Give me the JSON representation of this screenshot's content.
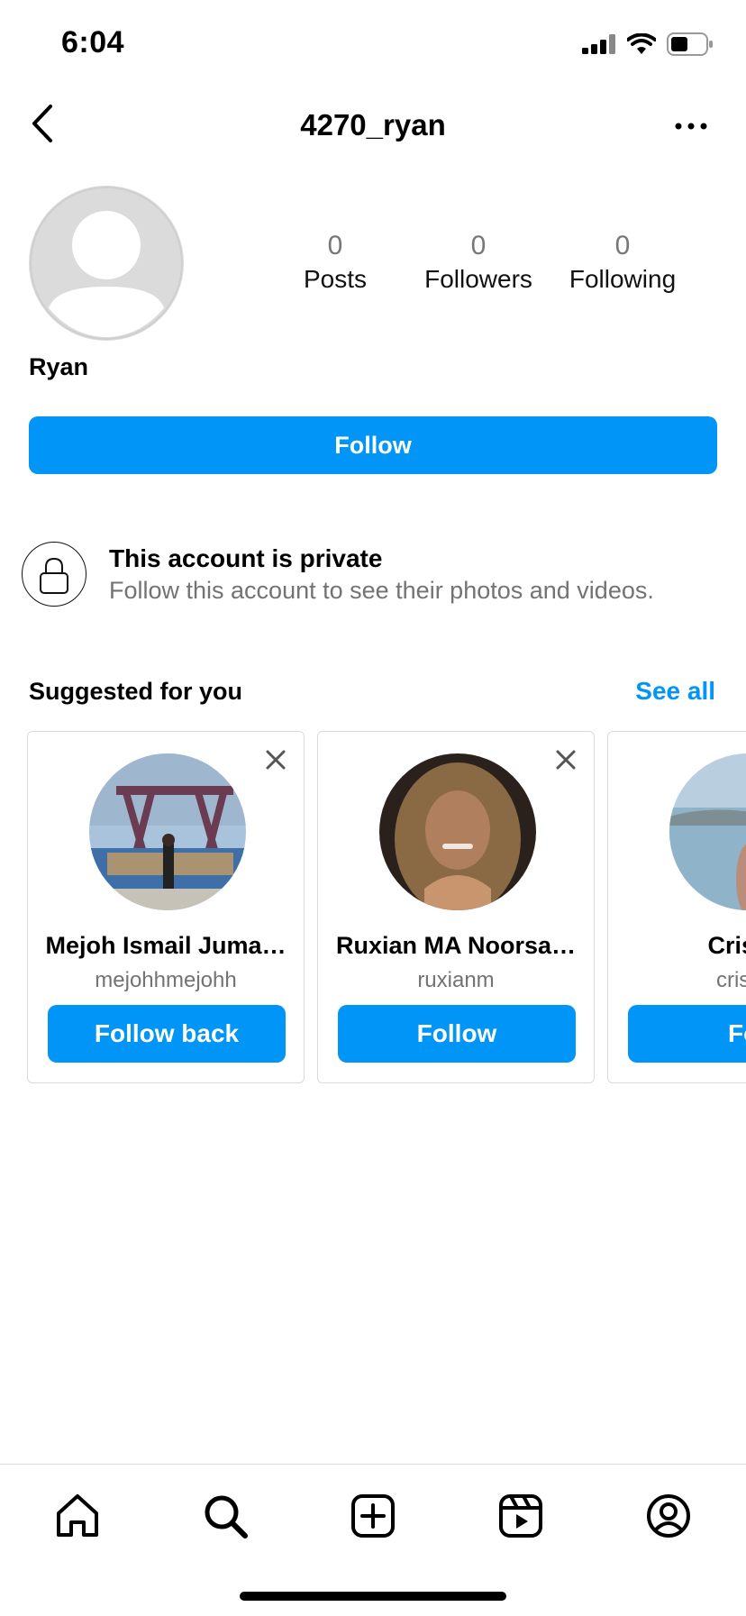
{
  "status_bar": {
    "time": "6:04"
  },
  "header": {
    "username": "4270_ryan"
  },
  "profile": {
    "display_name": "Ryan",
    "stats": [
      {
        "value": "0",
        "label": "Posts"
      },
      {
        "value": "0",
        "label": "Followers"
      },
      {
        "value": "0",
        "label": "Following"
      }
    ],
    "follow_label": "Follow"
  },
  "private_notice": {
    "title": "This account is private",
    "subtitle": "Follow this account to see their photos and videos."
  },
  "suggested": {
    "title": "Suggested for you",
    "see_all": "See all",
    "cards": [
      {
        "name": "Mejoh Ismail Juma…",
        "username": "mejohhmejohh",
        "button": "Follow back"
      },
      {
        "name": "Ruxian MA Noorsa…",
        "username": "ruxianm",
        "button": "Follow"
      },
      {
        "name": "Cris Ki",
        "username": "criskin",
        "button": "Fol"
      }
    ]
  },
  "nav": {
    "items": [
      "home-icon",
      "search-icon",
      "create-icon",
      "reels-icon",
      "profile-icon"
    ]
  },
  "colors": {
    "accent": "#0095f6",
    "muted": "#737373",
    "border": "#dbdbdb"
  }
}
